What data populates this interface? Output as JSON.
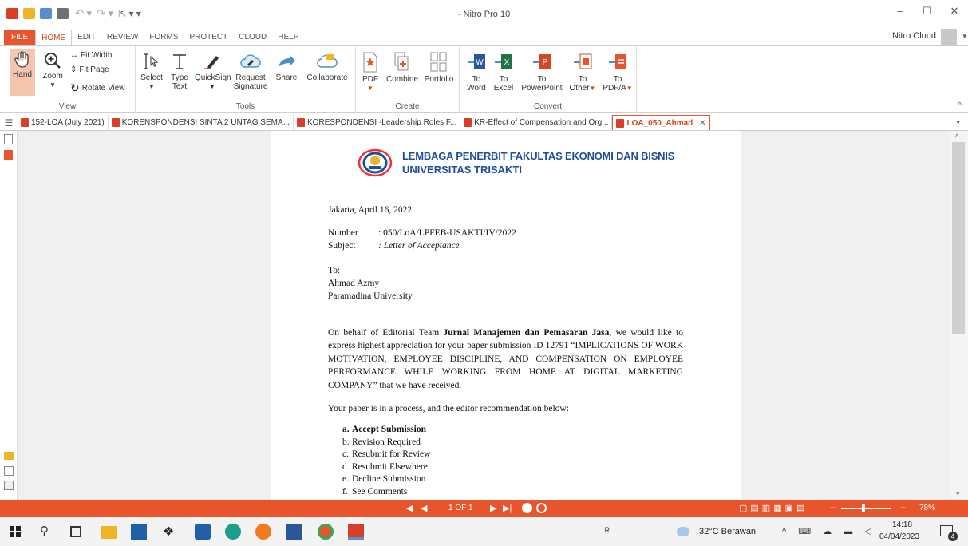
{
  "window": {
    "title": "- Nitro Pro 10"
  },
  "menu": [
    "FILE",
    "HOME",
    "EDIT",
    "REVIEW",
    "FORMS",
    "PROTECT",
    "CLOUD",
    "HELP"
  ],
  "account": "Nitro Cloud",
  "ribbon": {
    "view": {
      "label": "View",
      "hand": "Hand",
      "zoom": "Zoom",
      "fit_width": "Fit Width",
      "fit_page": "Fit Page",
      "rotate": "Rotate View"
    },
    "tools": {
      "label": "Tools",
      "select": "Select",
      "type_text_1": "Type",
      "type_text_2": "Text",
      "quicksign": "QuickSign",
      "request_1": "Request",
      "request_2": "Signature",
      "share": "Share",
      "collaborate": "Collaborate"
    },
    "create": {
      "label": "Create",
      "pdf": "PDF",
      "combine": "Combine",
      "portfolio": "Portfolio"
    },
    "convert": {
      "label": "Convert",
      "word_1": "To",
      "word_2": "Word",
      "excel_1": "To",
      "excel_2": "Excel",
      "ppt_1": "To",
      "ppt_2": "PowerPoint",
      "other_1": "To",
      "other_2": "Other",
      "pdfa_1": "To",
      "pdfa_2": "PDF/A"
    }
  },
  "tabs": [
    {
      "label": "152-LOA (July 2021)"
    },
    {
      "label": "KORENSPONDENSI SINTA 2 UNTAG SEMA..."
    },
    {
      "label": "KORESPONDENSI -Leadership Roles F..."
    },
    {
      "label": "KR-Effect of Compensation and Org..."
    },
    {
      "label": "LOA_050_Ahmad"
    }
  ],
  "document": {
    "header_1": "LEMBAGA PENERBIT FAKULTAS EKONOMI DAN BISNIS",
    "header_2": "UNIVERSITAS TRISAKTI",
    "logo_text": "LPFEB",
    "date": "Jakarta, April 16, 2022",
    "number_label": "Number",
    "number_value": ": 050/LoA/LPFEB-USAKTI/IV/2022",
    "subject_label": "Subject",
    "subject_value": ": Letter of Acceptance",
    "to_label": "To:",
    "to_name": "Ahmad Azmy",
    "to_inst": "Paramadina University",
    "body_prefix": "On behalf of Editorial Team ",
    "journal": "Jurnal Manajemen dan Pemasaran Jasa",
    "body_suffix": ", we would like to express highest appreciation for your paper submission ID 12791 “IMPLICATIONS OF WORK MOTIVATION, EMPLOYEE DISCIPLINE, AND COMPENSATION ON EMPLOYEE PERFORMANCE WHILE WORKING FROM HOME AT DIGITAL MARKETING COMPANY” that we have received.",
    "process": "Your paper is in a process, and the editor recommendation below:",
    "options": [
      {
        "mark": "a.",
        "text": "Accept Submission"
      },
      {
        "mark": "b.",
        "text": "Revision Required"
      },
      {
        "mark": "c.",
        "text": "Resubmit for Review"
      },
      {
        "mark": "d.",
        "text": "Resubmit Elsewhere"
      },
      {
        "mark": "e.",
        "text": "Decline Submission"
      },
      {
        "mark": "f.",
        "text": "See Comments"
      }
    ]
  },
  "status": {
    "page": "1 OF 1",
    "zoom": "78%"
  },
  "taskbar": {
    "weather": "32°C Berawan",
    "time": "14:18",
    "date": "04/04/2023",
    "notif_count": "4"
  },
  "colors": {
    "accent": "#e8542b",
    "doc_blue": "#1f4e9c"
  }
}
